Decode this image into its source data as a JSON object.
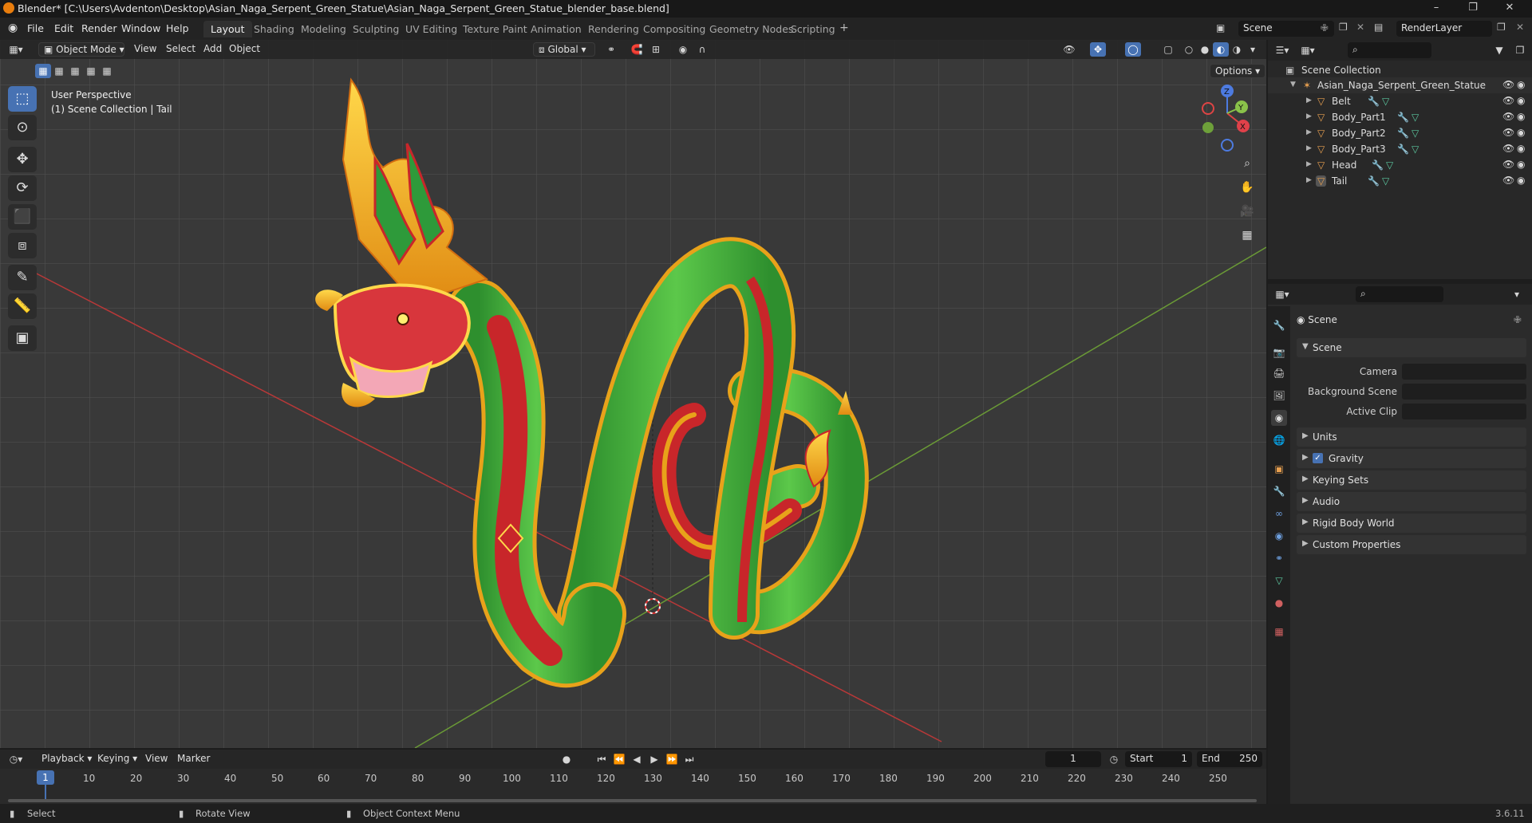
{
  "window": {
    "title": "Blender* [C:\\Users\\Avdenton\\Desktop\\Asian_Naga_Serpent_Green_Statue\\Asian_Naga_Serpent_Green_Statue_blender_base.blend]"
  },
  "menu": [
    "File",
    "Edit",
    "Render",
    "Window",
    "Help"
  ],
  "workspaces": [
    "Layout",
    "Shading",
    "Modeling",
    "Sculpting",
    "UV Editing",
    "Texture Paint",
    "Animation",
    "Rendering",
    "Compositing",
    "Geometry Nodes",
    "Scripting"
  ],
  "active_workspace": "Layout",
  "scene_name": "Scene",
  "render_layer": "RenderLayer",
  "viewport": {
    "mode": "Object Mode",
    "menus": [
      "View",
      "Select",
      "Add",
      "Object"
    ],
    "orientation": "Global",
    "options_label": "Options",
    "overlay_line1": "User Perspective",
    "overlay_line2": "(1) Scene Collection | Tail"
  },
  "outliner": {
    "root": "Scene Collection",
    "collection": "Asian_Naga_Serpent_Green_Statue",
    "objects": [
      "Belt",
      "Body_Part1",
      "Body_Part2",
      "Body_Part3",
      "Head",
      "Tail"
    ]
  },
  "properties": {
    "context": "Scene",
    "panel": "Scene",
    "fields": [
      {
        "label": "Camera"
      },
      {
        "label": "Background Scene"
      },
      {
        "label": "Active Clip"
      }
    ],
    "sections": [
      "Units",
      "Gravity",
      "Keying Sets",
      "Audio",
      "Rigid Body World",
      "Custom Properties"
    ]
  },
  "timeline": {
    "menus": [
      "Playback",
      "Keying",
      "View",
      "Marker"
    ],
    "current_frame": "1",
    "start_label": "Start",
    "start": "1",
    "end_label": "End",
    "end": "250",
    "ticks": [
      "1",
      "10",
      "20",
      "30",
      "40",
      "50",
      "60",
      "70",
      "80",
      "90",
      "100",
      "110",
      "120",
      "130",
      "140",
      "150",
      "160",
      "170",
      "180",
      "190",
      "200",
      "210",
      "220",
      "230",
      "240",
      "250"
    ]
  },
  "statusbar": {
    "select": "Select",
    "rotate": "Rotate View",
    "context": "Object Context Menu",
    "version": "3.6.11"
  },
  "colors": {
    "accent": "#4772b3",
    "viewport_bg": "#393939",
    "axis_x": "#c23b3b",
    "axis_y": "#6ea03a"
  }
}
